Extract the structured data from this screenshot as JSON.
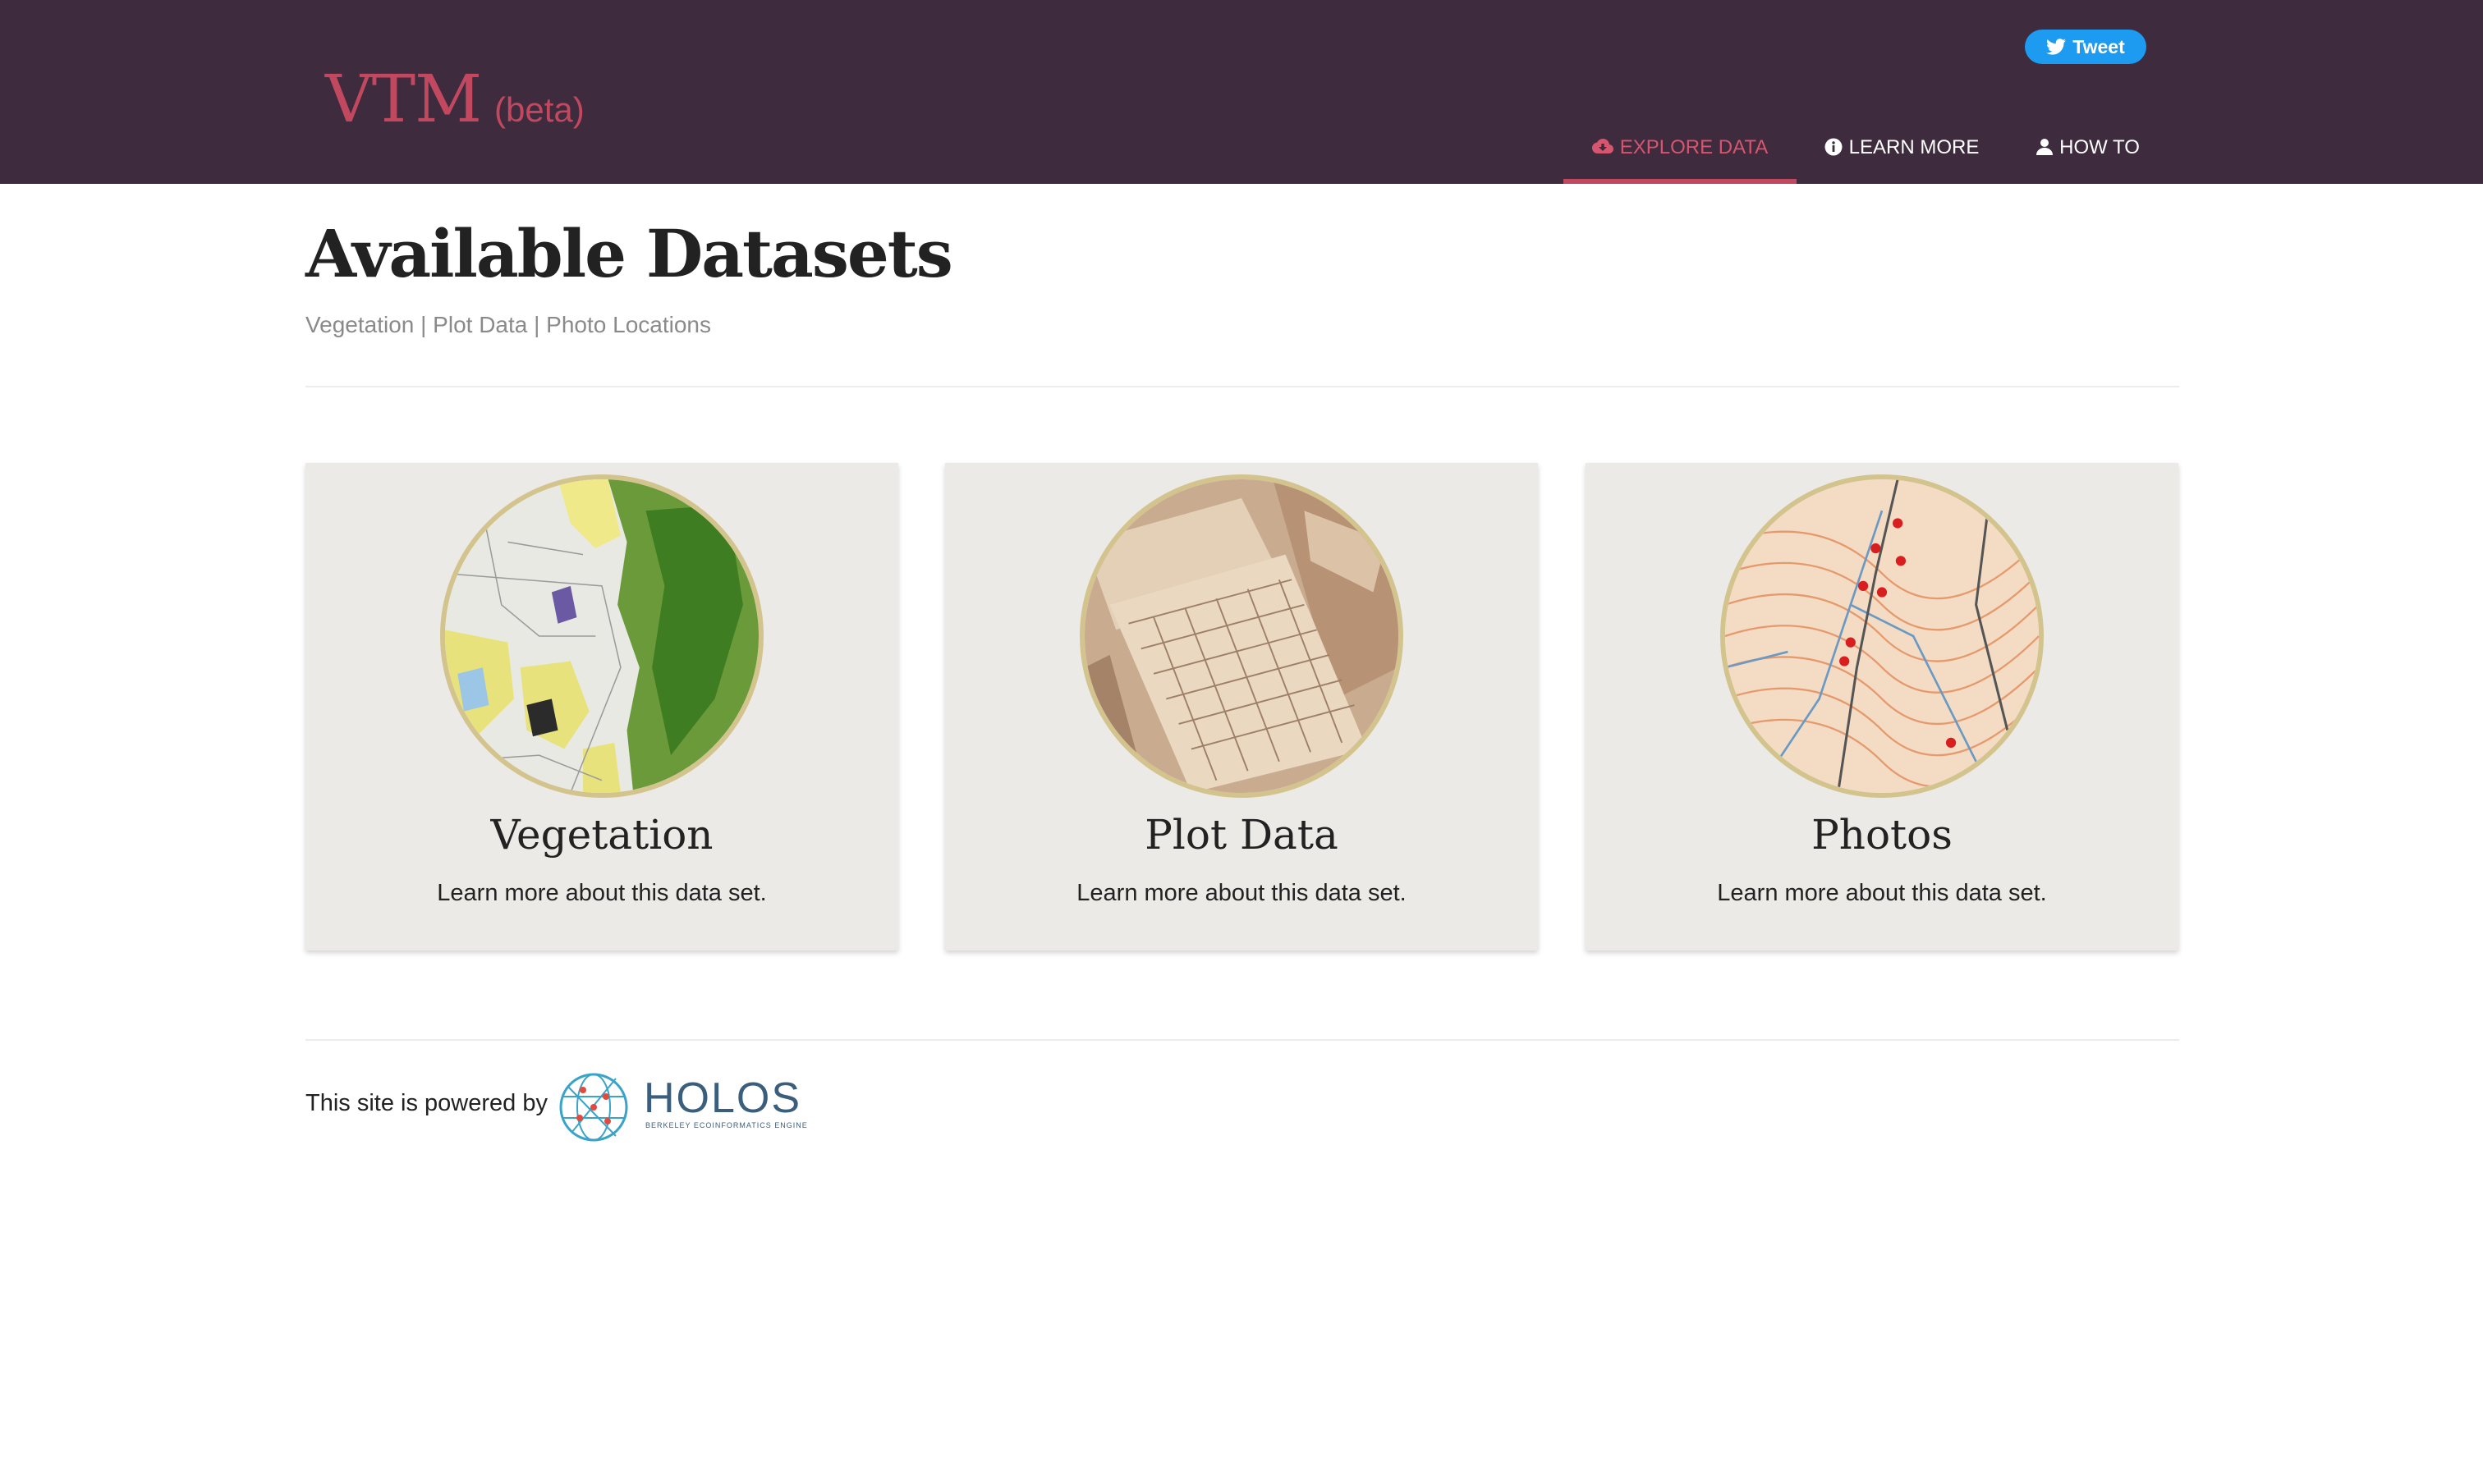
{
  "header": {
    "brand_title": "VTM",
    "brand_beta": "(beta)",
    "tweet_label": "Tweet",
    "nav": [
      {
        "label": "EXPLORE DATA",
        "icon": "cloud-download-icon",
        "active": true
      },
      {
        "label": "LEARN MORE",
        "icon": "info-circle-icon",
        "active": false
      },
      {
        "label": "HOW TO",
        "icon": "user-icon",
        "active": false
      }
    ]
  },
  "main": {
    "title": "Available Datasets",
    "subtitle": "Vegetation | Plot Data | Photo Locations",
    "cards": [
      {
        "title": "Vegetation",
        "description": "Learn more about this data set.",
        "image": "vegetation-map-image"
      },
      {
        "title": "Plot Data",
        "description": "Learn more about this data set.",
        "image": "plot-data-sheets-image"
      },
      {
        "title": "Photos",
        "description": "Learn more about this data set.",
        "image": "topographic-photo-map-image"
      }
    ]
  },
  "footer": {
    "powered_by": "This site is powered by",
    "logo_word": "HOLOS",
    "logo_tagline": "BERKELEY ECOINFORMATICS ENGINE"
  },
  "colors": {
    "header_bg": "#3e2c3e",
    "accent": "#c2485f",
    "card_bg": "#ebeae6",
    "tweet_blue": "#1d9bf0"
  }
}
